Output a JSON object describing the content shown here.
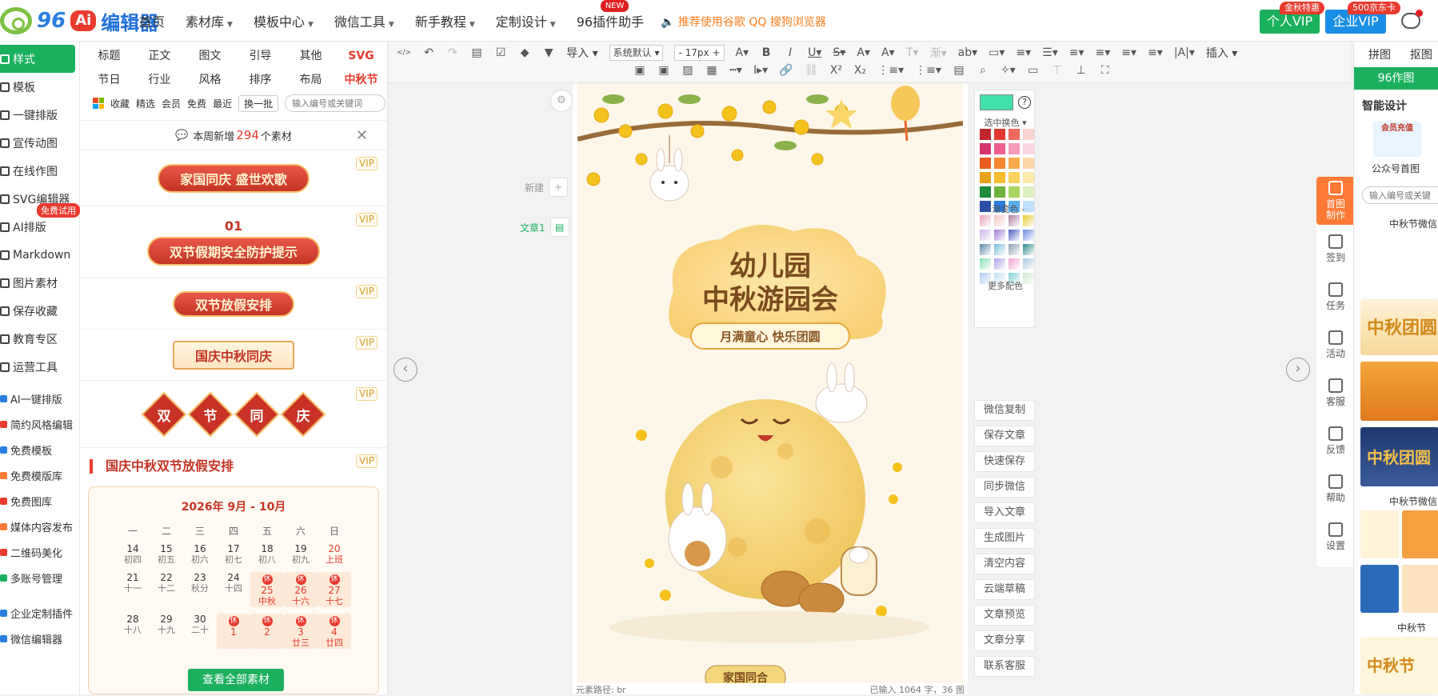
{
  "header": {
    "logo": {
      "num": "96",
      "ai": "Ai",
      "name": "编辑器"
    },
    "nav": [
      {
        "label": "首页",
        "caret": false
      },
      {
        "label": "素材库",
        "caret": true
      },
      {
        "label": "模板中心",
        "caret": true
      },
      {
        "label": "微信工具",
        "caret": true
      },
      {
        "label": "新手教程",
        "caret": true
      },
      {
        "label": "定制设计",
        "caret": true
      },
      {
        "label": "96插件助手",
        "caret": false,
        "badge": "NEW"
      }
    ],
    "browser_tip": "推荐使用谷歌 QQ 搜狗浏览器",
    "vip_personal": "个人VIP",
    "vip_personal_tag": "金秋特惠",
    "vip_company": "企业VIP",
    "vip_company_tag": "500京东卡"
  },
  "leftnav": {
    "items": [
      {
        "label": "样式",
        "active": true
      },
      {
        "label": "模板"
      },
      {
        "label": "一键排版"
      },
      {
        "label": "宣传动图"
      },
      {
        "label": "在线作图"
      },
      {
        "label": "SVG编辑器"
      },
      {
        "label": "AI排版"
      },
      {
        "label": "Markdown"
      },
      {
        "label": "图片素材"
      },
      {
        "label": "保存收藏"
      },
      {
        "label": "教育专区"
      },
      {
        "label": "运营工具"
      }
    ],
    "free_try": "免费试用",
    "tools": [
      {
        "label": "AI一键排版",
        "color": "#2a7de1"
      },
      {
        "label": "简约风格编辑",
        "color": "#e83b2e"
      },
      {
        "label": "免费模板",
        "color": "#2a7de1"
      },
      {
        "label": "免费模版库",
        "color": "#ff7a35"
      },
      {
        "label": "免费图库",
        "color": "#e83b2e"
      },
      {
        "label": "媒体内容发布",
        "color": "#ff7a35"
      },
      {
        "label": "二维码美化",
        "color": "#e83b2e"
      },
      {
        "label": "多账号管理",
        "color": "#1bb05d"
      }
    ],
    "tools2": [
      {
        "label": "企业定制插件",
        "color": "#2a7de1"
      },
      {
        "label": "微信编辑器",
        "color": "#2a7de1"
      }
    ]
  },
  "panel": {
    "categories": [
      {
        "label": "标题"
      },
      {
        "label": "正文"
      },
      {
        "label": "图文"
      },
      {
        "label": "引导"
      },
      {
        "label": "其他"
      },
      {
        "label": "SVG",
        "red": true
      },
      {
        "label": "节日"
      },
      {
        "label": "行业"
      },
      {
        "label": "风格"
      },
      {
        "label": "排序"
      },
      {
        "label": "布局"
      },
      {
        "label": "中秋节",
        "red": true
      }
    ],
    "filters": [
      "收藏",
      "精选",
      "会员",
      "免费",
      "最近"
    ],
    "swap": "换一批",
    "search_placeholder": "输入编号或关键词",
    "weekly_prefix": "本周新增",
    "weekly_count": "294",
    "weekly_suffix": "个素材",
    "vip": "VIP",
    "materials": [
      "家国同庆 盛世欢歌",
      "双节假期安全防护提示",
      "双节放假安排",
      "国庆中秋同庆"
    ],
    "material_num": "01",
    "diamonds": [
      "双",
      "节",
      "同",
      "庆"
    ],
    "calendar_section": "国庆中秋双节放假安排",
    "calendar_title": "2026年 9月 - 10月",
    "weekdays": [
      "一",
      "二",
      "三",
      "四",
      "五",
      "六",
      "日"
    ],
    "rest_mark": "休",
    "days": [
      {
        "d": "14",
        "l": "初四"
      },
      {
        "d": "15",
        "l": "初五"
      },
      {
        "d": "16",
        "l": "初六"
      },
      {
        "d": "17",
        "l": "初七"
      },
      {
        "d": "18",
        "l": "初八"
      },
      {
        "d": "19",
        "l": "初九"
      },
      {
        "d": "20",
        "l": "上班",
        "red": true
      },
      {
        "d": "21",
        "l": "十一"
      },
      {
        "d": "22",
        "l": "十二"
      },
      {
        "d": "23",
        "l": "秋分"
      },
      {
        "d": "24",
        "l": "十四"
      },
      {
        "d": "25",
        "l": "中秋",
        "hol": true
      },
      {
        "d": "26",
        "l": "十六",
        "hol": true
      },
      {
        "d": "27",
        "l": "十七",
        "hol": true
      },
      {
        "d": "28",
        "l": "十八"
      },
      {
        "d": "29",
        "l": "十九"
      },
      {
        "d": "30",
        "l": "二十"
      },
      {
        "d": "1",
        "l": "",
        "hol": true
      },
      {
        "d": "2",
        "l": "",
        "hol": true
      },
      {
        "d": "3",
        "l": "廿三",
        "hol": true
      },
      {
        "d": "4",
        "l": "廿四",
        "hol": true
      }
    ],
    "view_all": "查看全部素材"
  },
  "toolbar": {
    "import": "导入",
    "font": "系统默认",
    "size": "17px",
    "insert": "插入"
  },
  "canvas": {
    "new_label": "新建",
    "article_label": "文章1",
    "poster": {
      "title1": "幼儿园",
      "title2": "中秋游园会",
      "slogan": "月满童心  快乐团圆",
      "bottom": "家国同合"
    },
    "status_left": "元素路径:  br",
    "status_right": "已输入 1064 字，36 图"
  },
  "palette": {
    "current_color": "#40e0a8",
    "select_label": "选中换色",
    "gradient_label": "- 渐变色 -",
    "more": "更多配色",
    "solid": [
      "#c0272d",
      "#e03a2f",
      "#f06a5c",
      "#f9d3cf",
      "#d4336e",
      "#ef5f8f",
      "#f59ab8",
      "#fbd5e2",
      "#e85d20",
      "#f5892e",
      "#f9a94c",
      "#fbd7a8",
      "#e8a21a",
      "#f5bc2e",
      "#f9d35c",
      "#fbeaa8",
      "#1f8a3a",
      "#6db33f",
      "#a9d65f",
      "#dff0c0",
      "#2b4fa8",
      "#2a7de1",
      "#58aef0",
      "#bfe0fa",
      "#6a3ab0",
      "#9a6ad6",
      "#c2a0ea",
      "#b5543e"
    ],
    "gradient": [
      "#e9a0b8",
      "#f2c4c0",
      "#b27c9e",
      "#e8c82e",
      "#c8b4e8",
      "#9e7ad6",
      "#4a5ec0",
      "#6a8ae0",
      "#5a8aa8",
      "#7ac0e0",
      "#8aa0b0",
      "#2a8a8a",
      "#80e0b0",
      "#b0a0e8",
      "#f0a0d0",
      "#a8c8e0",
      "#a8c8f0",
      "#c0e0f0",
      "#80d0d8",
      "#d0e8d0"
    ]
  },
  "side_buttons": [
    "微信复制",
    "保存文章",
    "快速保存",
    "同步微信",
    "导入文章",
    "生成图片",
    "清空内容",
    "云端草稿",
    "文章预览",
    "文章分享",
    "联系客服"
  ],
  "right_tools": [
    {
      "label": "首图制作",
      "active": true
    },
    {
      "label": "签到"
    },
    {
      "label": "任务"
    },
    {
      "label": "活动"
    },
    {
      "label": "客服"
    },
    {
      "label": "反馈"
    },
    {
      "label": "帮助"
    },
    {
      "label": "设置"
    }
  ],
  "right_panel": {
    "tabs": [
      "拼图",
      "抠图"
    ],
    "main": "96作图",
    "smart": "智能设计",
    "recharge": "会员充值",
    "cover": "公众号首图",
    "search_placeholder": "输入编号或关键",
    "section1": "中秋节微信",
    "section2": "中秋节微信",
    "section3": "中秋节",
    "thumbs": [
      "中秋团圆",
      "中秋团圆",
      "中秋节"
    ]
  }
}
